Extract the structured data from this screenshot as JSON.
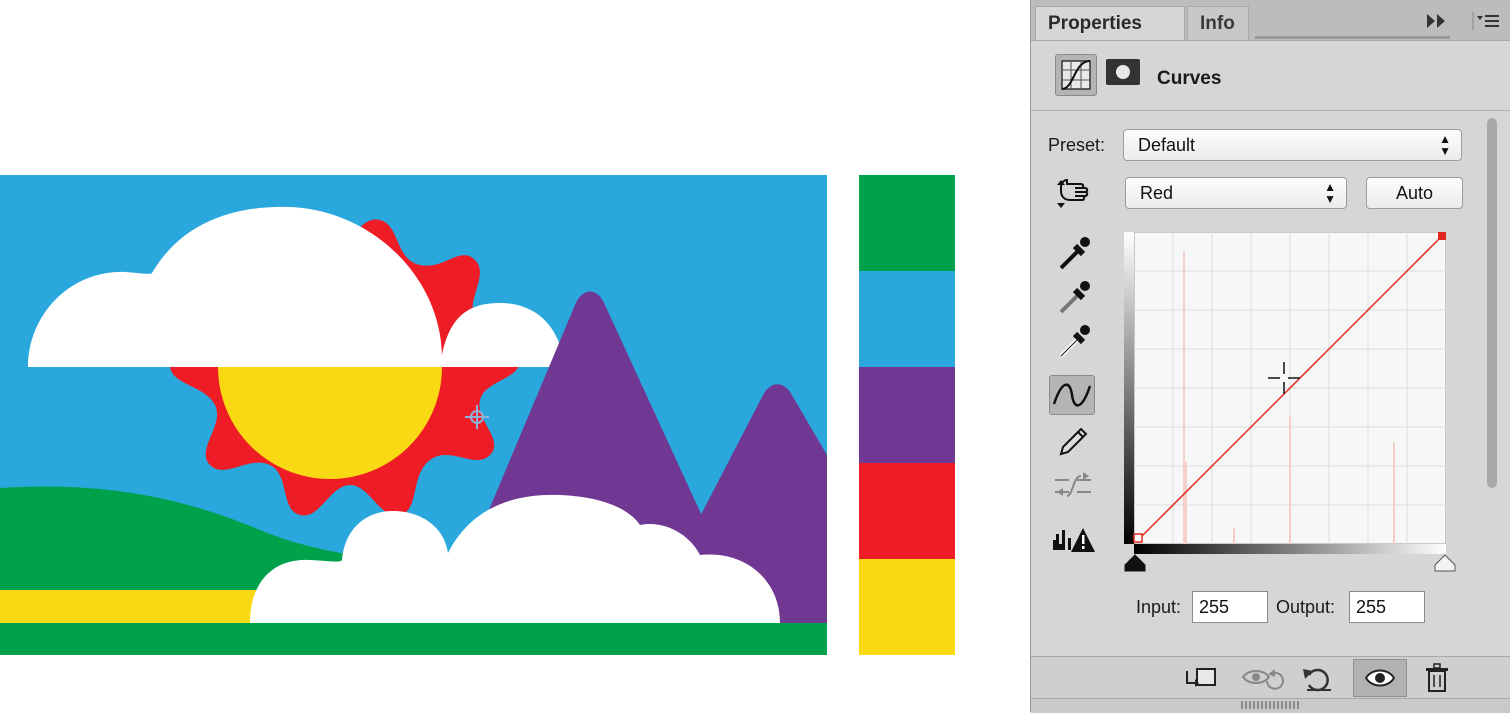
{
  "canvas": {
    "sky_color": "#2aa8de",
    "sun_color": "#f9d914",
    "sun_rays_color": "#ee1c25",
    "cloud_color": "#ffffff",
    "mountain_color": "#713893",
    "hill_color": "#00a14b",
    "stripe_color": "#f9d914",
    "ground_color": "#00a14b"
  },
  "swatches": [
    "#00a14b",
    "#2aa8de",
    "#713893",
    "#ee1c25",
    "#f9d914"
  ],
  "panel": {
    "tabs": [
      {
        "label": "Properties"
      },
      {
        "label": "Info"
      }
    ],
    "title": "Curves",
    "preset_label": "Preset:",
    "preset_value": "Default",
    "channel_value": "Red",
    "auto_label": "Auto",
    "input_label": "Input:",
    "input_value": "255",
    "output_label": "Output:",
    "output_value": "255",
    "curve_color": "#e0281e"
  },
  "icons": {
    "collapse": "double-arrow-right-icon",
    "menu": "panel-menu-icon",
    "adjustment": "curves-adjustment-icon",
    "mask": "layer-mask-icon",
    "hand": "targeted-adjustment-hand-icon",
    "eyedroppers": [
      "black-point-eyedropper-icon",
      "gray-point-eyedropper-icon",
      "white-point-eyedropper-icon"
    ],
    "curve": "edit-points-curve-icon",
    "pencil": "draw-pencil-icon",
    "smooth": "smooth-curve-icon",
    "clip": "clipping-warning-icon",
    "footer": [
      "clip-to-layer-icon",
      "view-previous-state-icon",
      "reset-icon",
      "visibility-eye-icon",
      "trash-icon"
    ]
  }
}
